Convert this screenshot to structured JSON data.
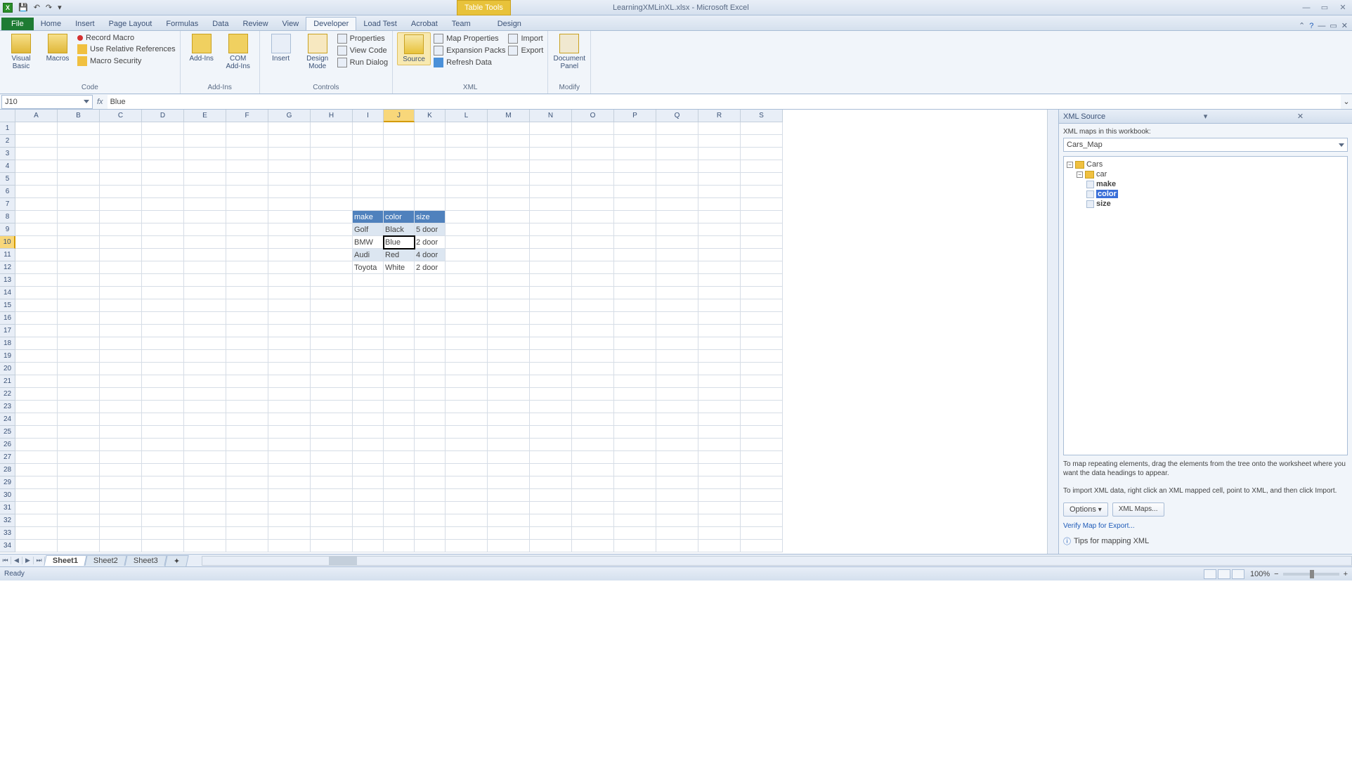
{
  "titlebar": {
    "filename": "LearningXMLinXL.xlsx - Microsoft Excel",
    "table_tools": "Table Tools"
  },
  "qat": {
    "save": "💾",
    "undo": "↶",
    "redo": "↷"
  },
  "tabs": {
    "file": "File",
    "home": "Home",
    "insert": "Insert",
    "page_layout": "Page Layout",
    "formulas": "Formulas",
    "data": "Data",
    "review": "Review",
    "view": "View",
    "developer": "Developer",
    "load_test": "Load Test",
    "acrobat": "Acrobat",
    "team": "Team",
    "design": "Design"
  },
  "ribbon": {
    "code": {
      "label": "Code",
      "vb": "Visual Basic",
      "macros": "Macros",
      "record": "Record Macro",
      "relref": "Use Relative References",
      "security": "Macro Security"
    },
    "addins": {
      "label": "Add-Ins",
      "addins": "Add-Ins",
      "com": "COM Add-Ins"
    },
    "controls": {
      "label": "Controls",
      "insert": "Insert",
      "design": "Design Mode",
      "props": "Properties",
      "viewcode": "View Code",
      "rundlg": "Run Dialog"
    },
    "xml": {
      "label": "XML",
      "source": "Source",
      "mapprops": "Map Properties",
      "expacks": "Expansion Packs",
      "refresh": "Refresh Data",
      "import": "Import",
      "export": "Export"
    },
    "modify": {
      "label": "Modify",
      "docpanel": "Document Panel"
    }
  },
  "formula_bar": {
    "name_box": "J10",
    "value": "Blue"
  },
  "columns": [
    "A",
    "B",
    "C",
    "D",
    "E",
    "F",
    "G",
    "H",
    "I",
    "J",
    "K",
    "L",
    "M",
    "N",
    "O",
    "P",
    "Q",
    "R",
    "S"
  ],
  "table": {
    "headers": [
      "make",
      "color",
      "size"
    ],
    "rows": [
      [
        "Golf",
        "Black",
        "5 door"
      ],
      [
        "BMW",
        "Blue",
        "2 door"
      ],
      [
        "Audi",
        "Red",
        "4 door"
      ],
      [
        "Toyota",
        "White",
        "2 door"
      ]
    ]
  },
  "active": {
    "row": 10,
    "col": "J"
  },
  "pane": {
    "title": "XML Source",
    "maps_label": "XML maps in this workbook:",
    "map_selected": "Cars_Map",
    "tree": {
      "root": "Cars",
      "car": "car",
      "make": "make",
      "color": "color",
      "size": "size"
    },
    "help1": "To map repeating elements, drag the elements from the tree onto the worksheet where you want the data headings to appear.",
    "help2": "To import XML data, right click an XML mapped cell, point to XML, and then click Import.",
    "options": "Options",
    "xmlmaps": "XML Maps...",
    "verify": "Verify Map for Export...",
    "tips": "Tips for mapping XML"
  },
  "sheets": [
    "Sheet1",
    "Sheet2",
    "Sheet3"
  ],
  "status": {
    "ready": "Ready",
    "zoom": "100%"
  }
}
